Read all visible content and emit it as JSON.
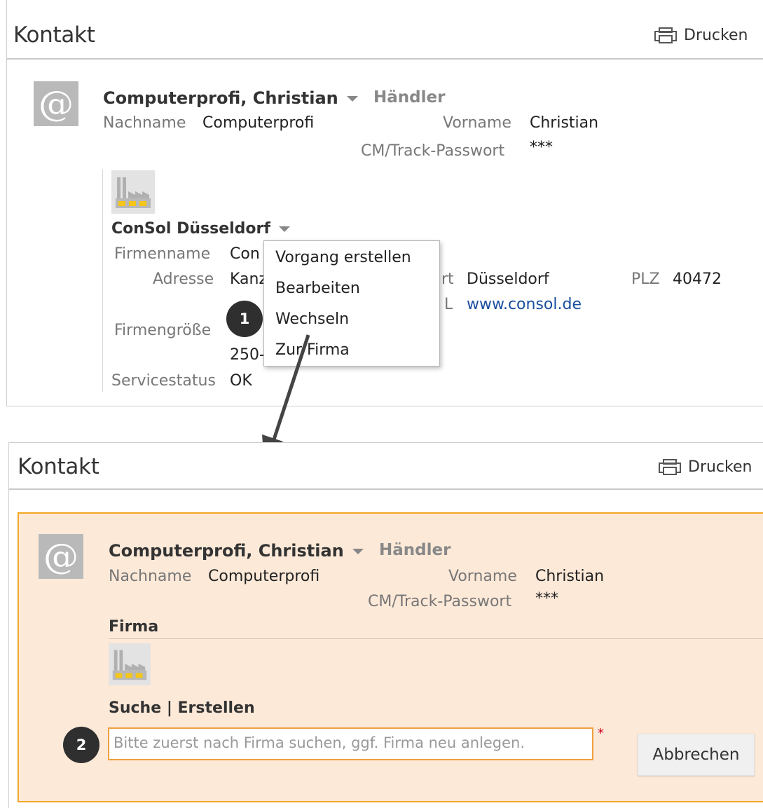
{
  "top": {
    "title": "Kontakt",
    "print_label": "Drucken",
    "contact": {
      "avatar": "@",
      "name": "Computerprofi, Christian",
      "role": "Händler",
      "nachname_label": "Nachname",
      "nachname_value": "Computerprofi",
      "vorname_label": "Vorname",
      "vorname_value": "Christian",
      "password_label": "CM/Track-Passwort",
      "password_value": "***"
    },
    "company": {
      "name": "ConSol Düsseldorf",
      "firmenname_label": "Firmenname",
      "firmenname_value": "Con",
      "adresse_label": "Adresse",
      "adresse_value": "Kanz",
      "ort_label_fragment": "rt",
      "ort_value": "Düsseldorf",
      "plz_label": "PLZ",
      "plz_value": "40472",
      "url_label_fragment": "L",
      "url_value": "www.consol.de",
      "groesse_label": "Firmengröße",
      "groesse_value_fragment": "250-",
      "servicestatus_label": "Servicestatus",
      "servicestatus_value": "OK"
    },
    "menu": [
      "Vorgang erstellen",
      "Bearbeiten",
      "Wechseln",
      "Zur Firma"
    ],
    "step_badge": "1"
  },
  "bottom": {
    "title": "Kontakt",
    "print_label": "Drucken",
    "contact": {
      "avatar": "@",
      "name": "Computerprofi, Christian",
      "role": "Händler",
      "nachname_label": "Nachname",
      "nachname_value": "Computerprofi",
      "vorname_label": "Vorname",
      "vorname_value": "Christian",
      "password_label": "CM/Track-Passwort",
      "password_value": "***"
    },
    "firma_heading": "Firma",
    "search_link": "Suche",
    "separator": "|",
    "create_link": "Erstellen",
    "search_placeholder": "Bitte zuerst nach Firma suchen, ggf. Firma neu anlegen.",
    "required_mark": "*",
    "cancel_label": "Abbrechen",
    "step_badge": "2"
  },
  "colors": {
    "edit_background": "#fde9d8",
    "edit_border": "#f5a623",
    "link": "#1a4fa0",
    "badge": "#2f2f2f",
    "factory_yellow": "#f5c518"
  }
}
